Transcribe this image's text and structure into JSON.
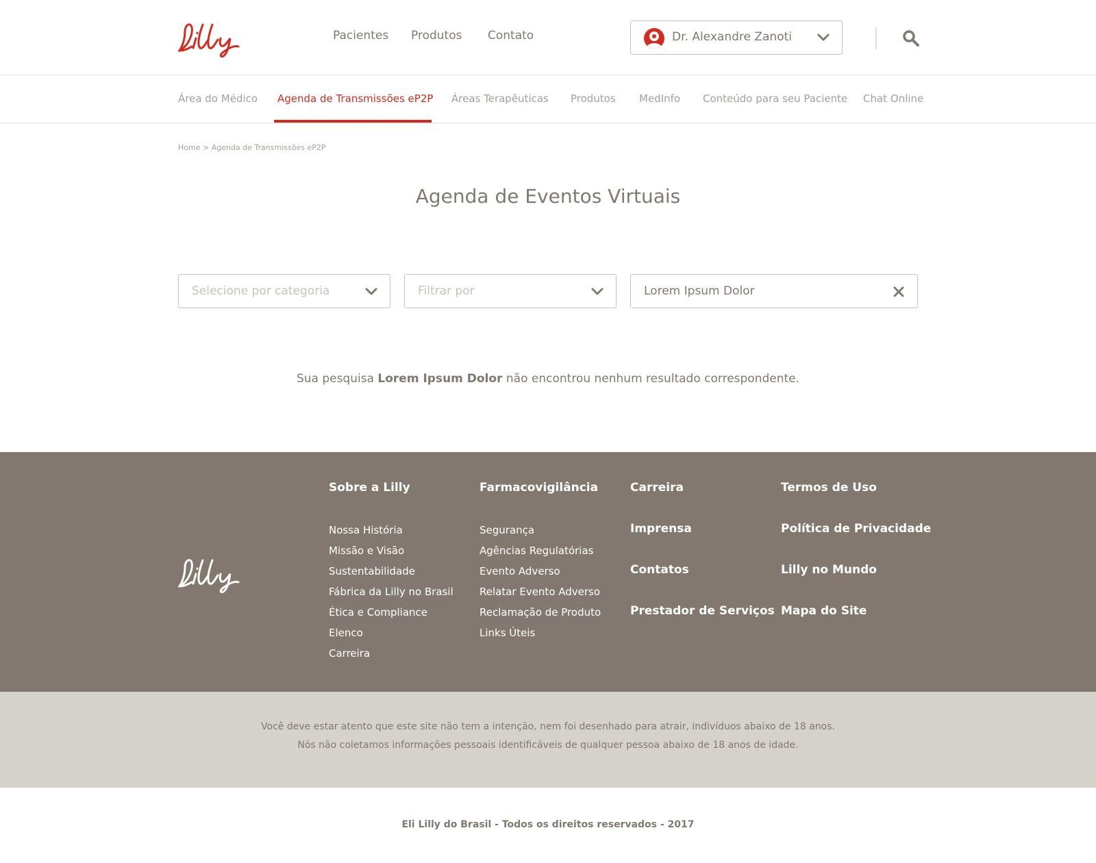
{
  "brand": {
    "logo_text": "Lilly",
    "accent_color": "#d52b1e",
    "text_color": "#82786f",
    "footer_bg": "#82786f",
    "disclaimer_bg": "#d5d2cb"
  },
  "header": {
    "nav": [
      "Pacientes",
      "Produtos",
      "Contato"
    ],
    "user": {
      "name": "Dr. Alexandre Zanoti",
      "avatar_icon": "user-avatar-icon",
      "toggle_icon": "chevron-down-icon"
    },
    "search_icon": "search-icon"
  },
  "subnav": {
    "items": [
      "Área do Médico",
      "Agenda de Transmissões eP2P",
      "Áreas Terapêuticas",
      "Produtos",
      "MedInfo",
      "Conteúdo para seu Paciente",
      "Chat Online"
    ],
    "active": "Agenda de Transmissões eP2P"
  },
  "breadcrumb": {
    "home": "Home",
    "separator": ">",
    "current": "Agenda de Transmissões eP2P"
  },
  "main": {
    "title": "Agenda de Eventos Virtuais",
    "filters": {
      "category_placeholder": "Selecione por categoria",
      "filter_placeholder": "Filtrar por",
      "search_value": "Lorem Ipsum Dolor"
    },
    "no_results": {
      "prefix": "Sua pesquisa",
      "query": "Lorem Ipsum Dolor",
      "suffix": "não encontrou nenhum resultado correspondente."
    }
  },
  "footer": {
    "col1": {
      "title": "Sobre a Lilly",
      "links": [
        "Nossa História",
        "Missão e Visão",
        "Sustentabilidade",
        "Fábrica da Lilly no Brasil",
        "Ética e Compliance",
        "Elenco",
        "Carreira"
      ]
    },
    "col2": {
      "title": "Farmacovigilância",
      "links": [
        "Segurança",
        "Agências Regulatórias",
        "Evento Adverso",
        "Relatar Evento Adverso",
        "Reclamação de Produto",
        "Links Úteis"
      ]
    },
    "col3": [
      "Carreira",
      "Imprensa",
      "Contatos",
      "Prestador de Serviços"
    ],
    "col4": [
      "Termos de Uso",
      "Política de Privacidade",
      "Lilly no Mundo",
      "Mapa do Site"
    ],
    "disclaimer": [
      "Você deve estar atento que este site não tem a intenção, nem foi desenhado para atrair, indivíduos abaixo de 18 anos.",
      "Nós não coletamos informações pessoais identificáveis de qualquer pessoa abaixo de 18 anos de idade."
    ],
    "copyright": "Eli Lilly do Brasil - Todos os direitos reservados - 2017"
  }
}
